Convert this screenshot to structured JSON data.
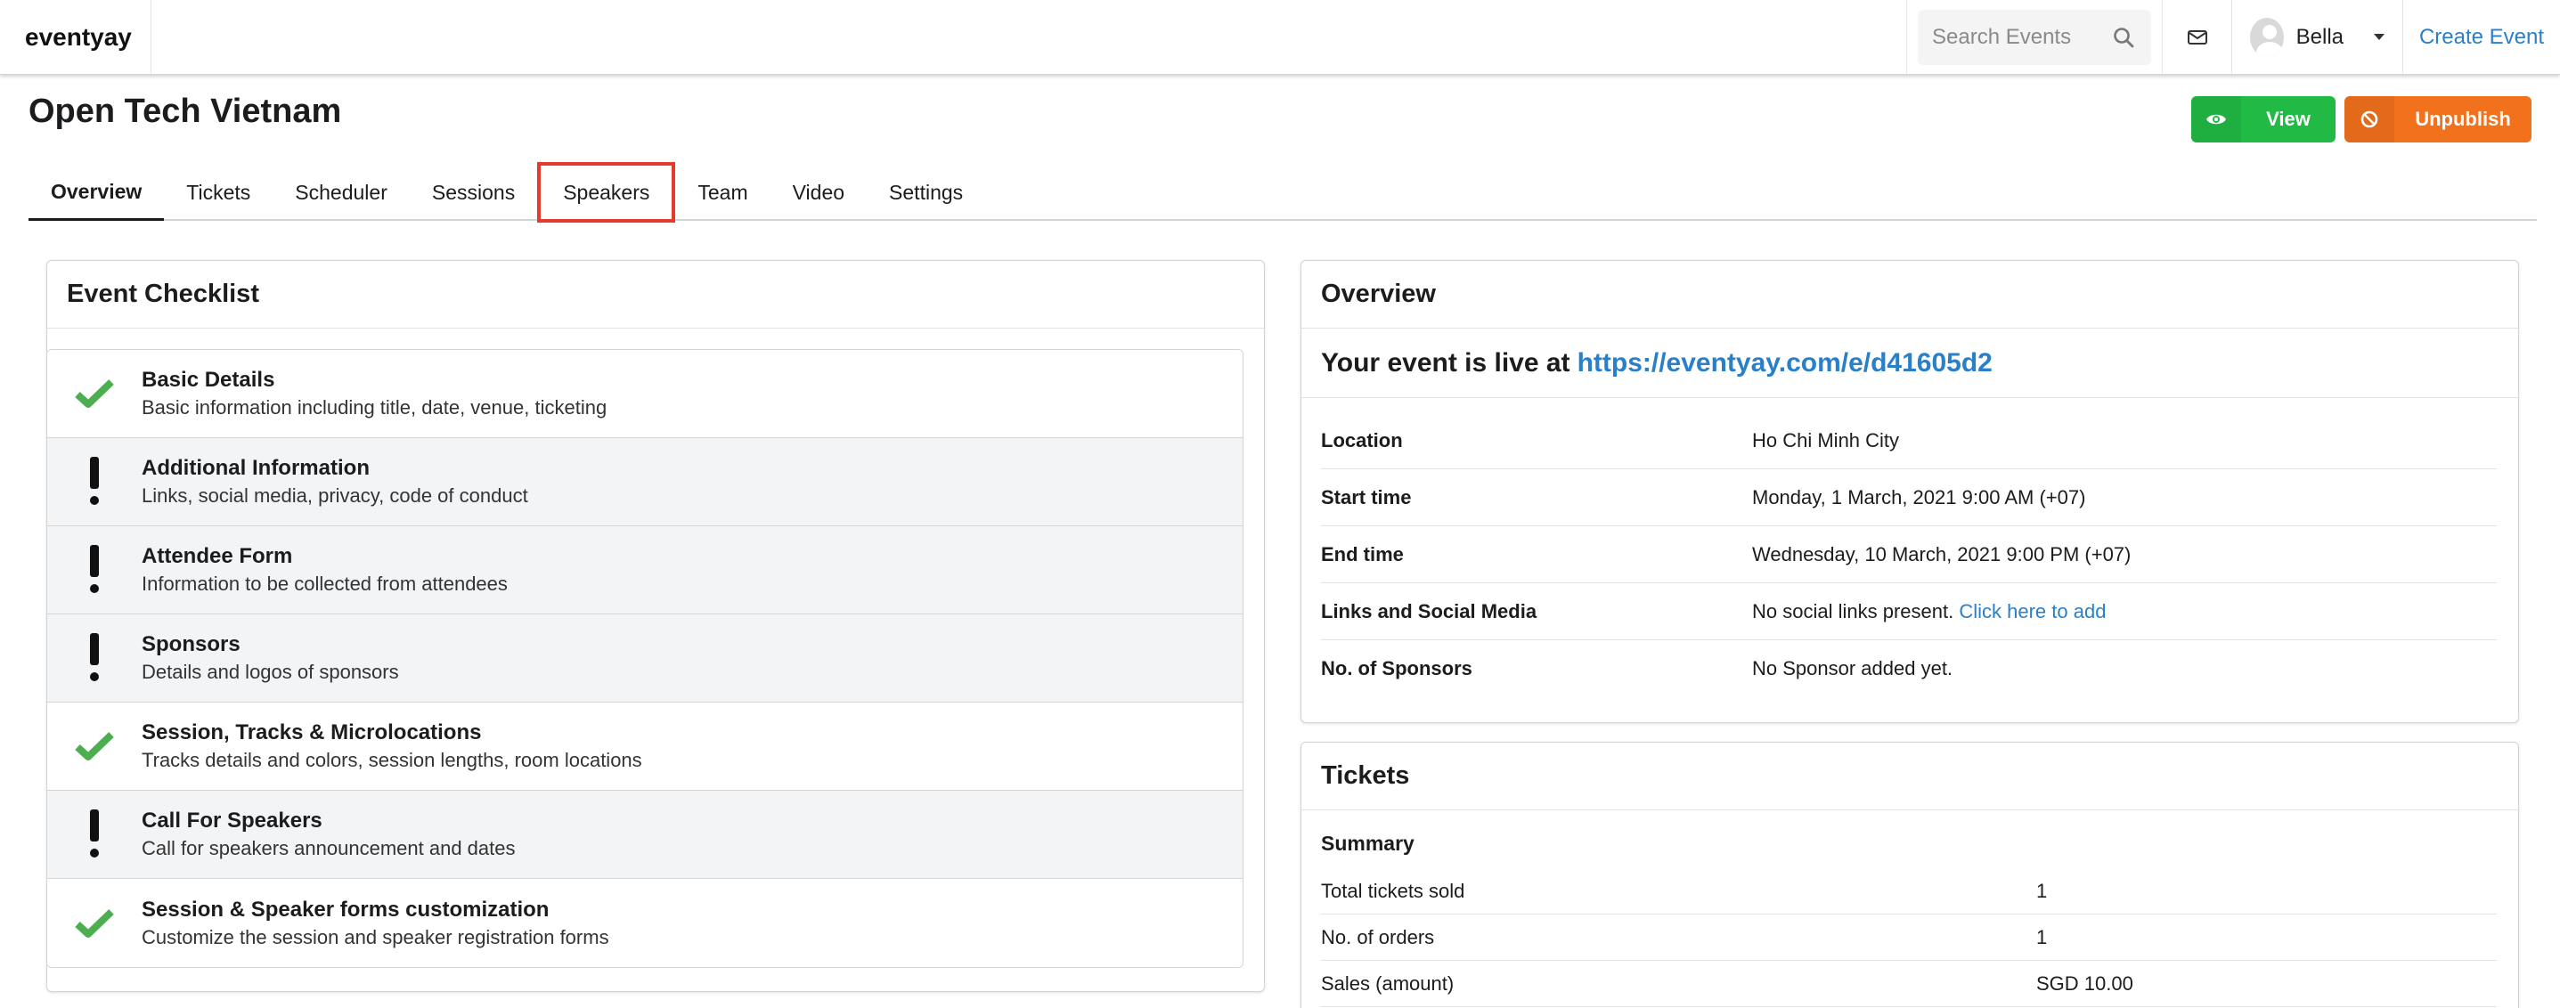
{
  "app": {
    "brand": "eventyay"
  },
  "topnav": {
    "search_placeholder": "Search Events",
    "user_name": "Bella",
    "create_event": "Create Event"
  },
  "header": {
    "title": "Open Tech Vietnam",
    "view_label": "View",
    "unpublish_label": "Unpublish"
  },
  "tabs": [
    "Overview",
    "Tickets",
    "Scheduler",
    "Sessions",
    "Speakers",
    "Team",
    "Video",
    "Settings"
  ],
  "checklist": {
    "title": "Event Checklist",
    "items": [
      {
        "title": "Basic Details",
        "desc": "Basic information including title, date, venue, ticketing",
        "status": "done"
      },
      {
        "title": "Additional Information",
        "desc": "Links, social media, privacy, code of conduct",
        "status": "todo"
      },
      {
        "title": "Attendee Form",
        "desc": "Information to be collected from attendees",
        "status": "todo"
      },
      {
        "title": "Sponsors",
        "desc": "Details and logos of sponsors",
        "status": "todo"
      },
      {
        "title": "Session, Tracks & Microlocations",
        "desc": "Tracks details and colors, session lengths, room locations",
        "status": "done"
      },
      {
        "title": "Call For Speakers",
        "desc": "Call for speakers announcement and dates",
        "status": "todo"
      },
      {
        "title": "Session & Speaker forms customization",
        "desc": "Customize the session and speaker registration forms",
        "status": "done"
      }
    ]
  },
  "overview": {
    "title": "Overview",
    "live_prefix": "Your event is live at",
    "live_url": "https://eventyay.com/e/d41605d2",
    "rows": [
      {
        "key": "Location",
        "value": "Ho Chi Minh City"
      },
      {
        "key": "Start time",
        "value": "Monday, 1 March, 2021 9:00 AM (+07)"
      },
      {
        "key": "End time",
        "value": "Wednesday, 10 March, 2021 9:00 PM (+07)"
      },
      {
        "key": "Links and Social Media",
        "value": "No social links present.",
        "link": "Click here to add"
      },
      {
        "key": "No. of Sponsors",
        "value": "No Sponsor added yet."
      }
    ]
  },
  "tickets": {
    "title": "Tickets",
    "summary_label": "Summary",
    "rows": [
      {
        "key": "Total tickets sold",
        "value": "1"
      },
      {
        "key": "No. of orders",
        "value": "1"
      },
      {
        "key": "Sales (amount)",
        "value": "SGD 10.00"
      }
    ]
  },
  "colors": {
    "green": "#21ba45",
    "orange": "#f2711c",
    "link": "#2a7fc9",
    "highlight": "#e53a2e",
    "check": "#4cae4f"
  }
}
